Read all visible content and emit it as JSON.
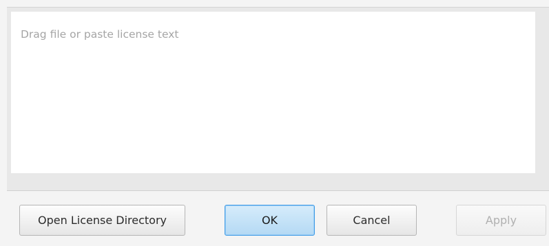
{
  "license_input": {
    "value": "",
    "placeholder": "Drag file or paste license text"
  },
  "buttons": {
    "open_license_directory": "Open License Directory",
    "ok": "OK",
    "cancel": "Cancel",
    "apply": "Apply"
  },
  "states": {
    "ok_default": true,
    "apply_disabled": true
  },
  "colors": {
    "panel_background": "#e8e8e8",
    "window_background": "#f4f4f4",
    "default_button_border": "#3f9be6",
    "default_button_fill": "#c4e2f8",
    "disabled_text": "#b0b0b0",
    "placeholder_text": "#a5a5a5"
  }
}
